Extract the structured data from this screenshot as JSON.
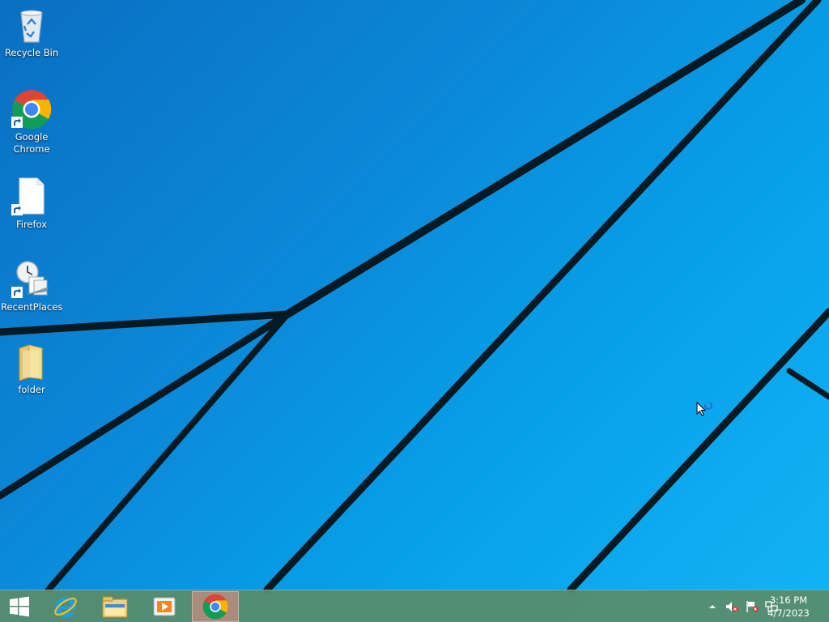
{
  "desktop": {
    "icons": [
      {
        "label": "Recycle Bin",
        "icon": "recycle-bin-icon"
      },
      {
        "label": "Google Chrome",
        "icon": "chrome-icon"
      },
      {
        "label": "Firefox",
        "icon": "file-icon"
      },
      {
        "label": "RecentPlaces",
        "icon": "recent-places-icon"
      },
      {
        "label": "folder",
        "icon": "folder-icon"
      }
    ]
  },
  "taskbar": {
    "buttons": [
      {
        "icon": "windows-logo-icon"
      },
      {
        "icon": "internet-explorer-icon"
      },
      {
        "icon": "file-explorer-icon"
      },
      {
        "icon": "media-player-icon"
      },
      {
        "icon": "chrome-icon",
        "active": true
      }
    ],
    "tray": {
      "icons": [
        "show-hidden-icons-chevron",
        "volume-muted-icon",
        "action-center-flag-icon",
        "network-icon"
      ],
      "time": "3:16 PM",
      "date": "4/7/2023"
    }
  },
  "colors": {
    "wallpaper_light": "#12b4f5",
    "wallpaper_dark": "#0a6fc2",
    "taskbar": "#5a8c69",
    "active_task": "#e88c82"
  }
}
